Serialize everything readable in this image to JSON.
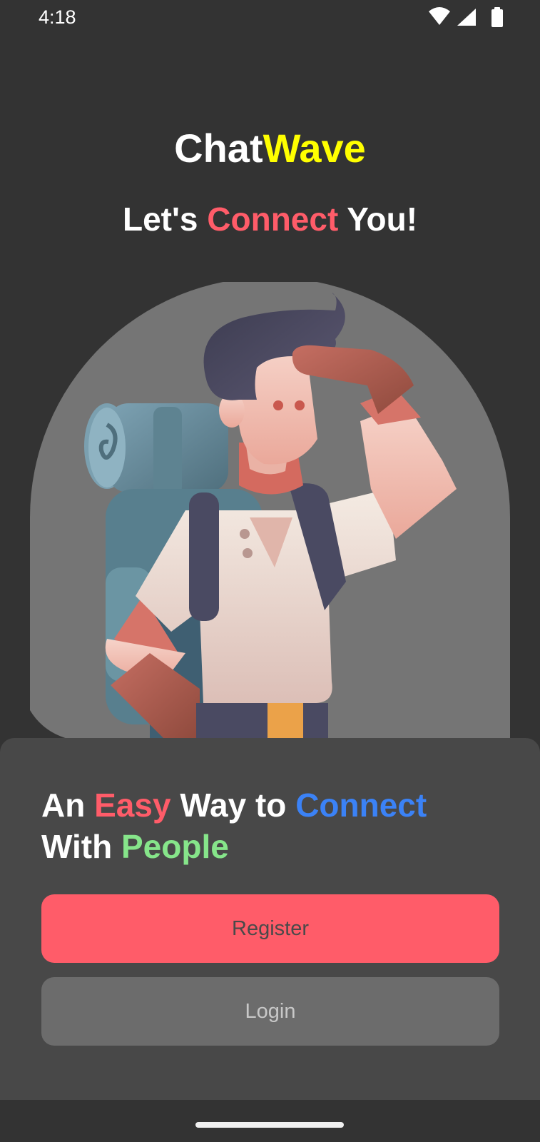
{
  "status_bar": {
    "time": "4:18",
    "icons": [
      "wifi-icon",
      "cellular-signal-icon",
      "battery-icon"
    ]
  },
  "header": {
    "title_part1": "Chat",
    "title_part2": "Wave",
    "tagline_part1": "Let's ",
    "tagline_part2": "Connect",
    "tagline_part3": " You!"
  },
  "illustration": {
    "name": "backpacker-illustration"
  },
  "bottom_sheet": {
    "headline_word1": "An ",
    "headline_word2": "Easy",
    "headline_word3": " Way to ",
    "headline_word4": "Connect",
    "headline_word5": " With ",
    "headline_word6": "People",
    "register_label": "Register",
    "login_label": "Login"
  },
  "colors": {
    "background": "#333333",
    "sheet": "#484848",
    "title_accent": "#ffff00",
    "red_accent": "#ff5c69",
    "blue_accent": "#3b82f6",
    "green_accent": "#86e58a",
    "register_button": "#ff5c69",
    "login_button": "#6c6c6c"
  }
}
